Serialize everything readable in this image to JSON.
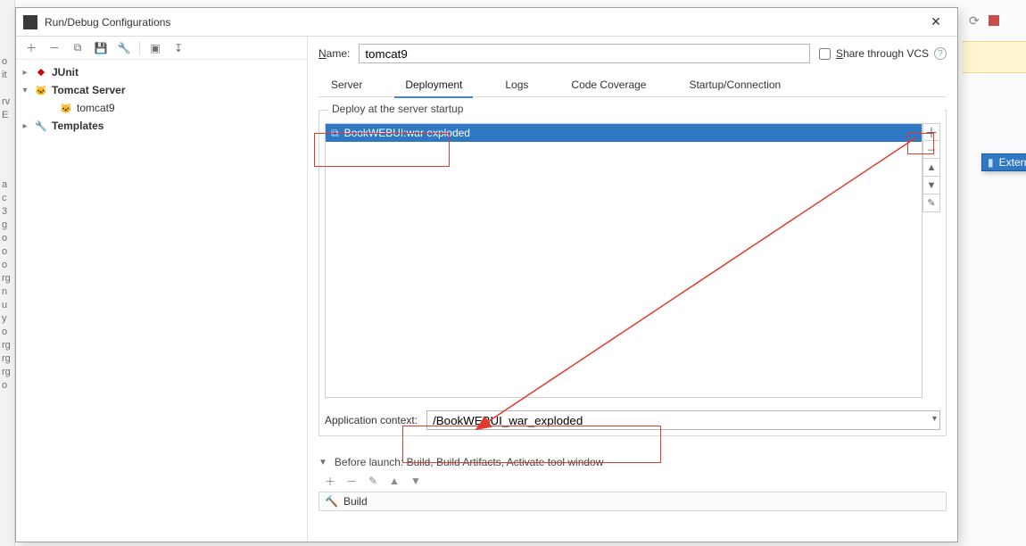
{
  "window": {
    "title": "Run/Debug Configurations"
  },
  "sidebar": {
    "items": [
      {
        "label": "JUnit",
        "icon": "junit-icon"
      },
      {
        "label": "Tomcat Server",
        "icon": "tomcat-icon"
      },
      {
        "label": "tomcat9",
        "icon": "tomcat-icon"
      },
      {
        "label": "Templates",
        "icon": "wrench-icon"
      }
    ]
  },
  "name": {
    "label_prefix": "N",
    "label_rest": "ame:",
    "value": "tomcat9"
  },
  "share": {
    "label_prefix": "S",
    "label_rest": "hare through VCS"
  },
  "tabs": [
    {
      "label": "Server"
    },
    {
      "label": "Deployment"
    },
    {
      "label": "Logs"
    },
    {
      "label": "Code Coverage"
    },
    {
      "label": "Startup/Connection"
    }
  ],
  "deployment": {
    "legend": "Deploy at the server startup",
    "items": [
      {
        "label": "BookWEBUI:war exploded"
      }
    ],
    "app_context_label": "Application context:",
    "app_context_value": "/BookWEBUI_war_exploded"
  },
  "before_launch": {
    "label": "Before launch: Build, Build Artifacts, Activate tool window",
    "build_label": "Build"
  },
  "popup": {
    "label": "External Source..."
  }
}
